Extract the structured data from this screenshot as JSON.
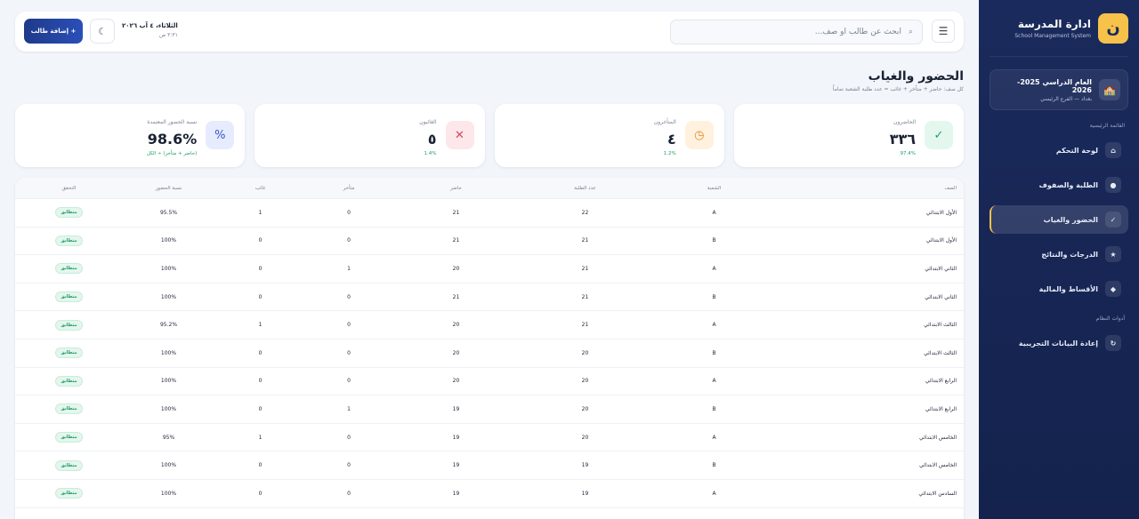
{
  "sidebar": {
    "brand_logo": "ن",
    "brand_title": "ادارة المدرسة",
    "brand_subtitle": "School Management System",
    "year_title": "العام الدراسي 2025-2026",
    "year_sub": "بغداد — الفرع الرئيسي",
    "section_main": "القائمة الرئيسية",
    "section_tools": "أدوات النظام",
    "items": [
      {
        "label": "لوحة التحكم",
        "icon": "⌂"
      },
      {
        "label": "الطلبة والصفوف",
        "icon": "●"
      },
      {
        "label": "الحضور والغياب",
        "icon": "✓"
      },
      {
        "label": "الدرجات والنتائج",
        "icon": "★"
      },
      {
        "label": "الأقساط والمالية",
        "icon": "◆"
      }
    ],
    "tool_item": {
      "label": "إعادة البيانات التجريبية",
      "icon": "↻"
    }
  },
  "topbar": {
    "search_placeholder": "ابحث عن طالب أو صف...",
    "date": "الثلاثاء، ٤ آب ٢٠٢٦",
    "time": "٣:٣١ ص",
    "add_label": "+ إضافة طالب"
  },
  "header": {
    "title": "الحضور والغياب",
    "subtitle": "كل صف: حاضر + متأخر + غائب = عدد طلبة الشعبة تماماً"
  },
  "cards": [
    {
      "label": "الحاضرون",
      "value": "٣٣٦",
      "foot": "97.4%",
      "icon": "✓",
      "icon_bg": "#e3f7ee",
      "icon_color": "#1e9e63"
    },
    {
      "label": "المتأخرون",
      "value": "٤",
      "foot": "1.2%",
      "icon": "◷",
      "icon_bg": "#fff1de",
      "icon_color": "#e08a1e"
    },
    {
      "label": "الغائبون",
      "value": "٥",
      "foot": "1.4%",
      "icon": "✕",
      "icon_bg": "#fde7ea",
      "icon_color": "#d9455f"
    },
    {
      "label": "نسبة الحضور المعتمدة",
      "value": "98.6%",
      "foot": "(حاضر + متأخر) ÷ الكل",
      "icon": "%",
      "icon_bg": "#e6ecfd",
      "icon_color": "#3556c9"
    }
  ],
  "table": {
    "headers": [
      "الصف",
      "الشعبة",
      "عدد الطلبة",
      "حاضر",
      "متأخر",
      "غائب",
      "نسبة الحضور",
      "التحقق"
    ],
    "rows": [
      [
        "الأول الابتدائي",
        "A",
        "22",
        "21",
        "0",
        "1",
        "95.5%",
        "متطابق"
      ],
      [
        "الأول الابتدائي",
        "B",
        "21",
        "21",
        "0",
        "0",
        "100%",
        "متطابق"
      ],
      [
        "الثاني الابتدائي",
        "A",
        "21",
        "20",
        "1",
        "0",
        "100%",
        "متطابق"
      ],
      [
        "الثاني الابتدائي",
        "B",
        "21",
        "21",
        "0",
        "0",
        "100%",
        "متطابق"
      ],
      [
        "الثالث الابتدائي",
        "A",
        "21",
        "20",
        "0",
        "1",
        "95.2%",
        "متطابق"
      ],
      [
        "الثالث الابتدائي",
        "B",
        "20",
        "20",
        "0",
        "0",
        "100%",
        "متطابق"
      ],
      [
        "الرابع الابتدائي",
        "A",
        "20",
        "20",
        "0",
        "0",
        "100%",
        "متطابق"
      ],
      [
        "الرابع الابتدائي",
        "B",
        "20",
        "19",
        "1",
        "0",
        "100%",
        "متطابق"
      ],
      [
        "الخامس الابتدائي",
        "A",
        "20",
        "19",
        "0",
        "1",
        "95%",
        "متطابق"
      ],
      [
        "الخامس الابتدائي",
        "B",
        "19",
        "19",
        "0",
        "0",
        "100%",
        "متطابق"
      ],
      [
        "السادس الابتدائي",
        "A",
        "19",
        "19",
        "0",
        "0",
        "100%",
        "متطابق"
      ]
    ]
  }
}
